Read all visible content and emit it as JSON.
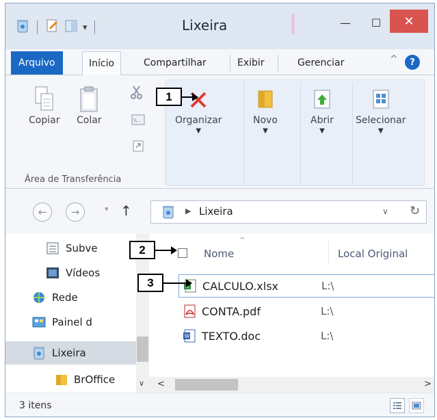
{
  "window": {
    "title": "Lixeira",
    "accent_color": "#1a68c4",
    "close_glyph": "✕",
    "minimize_glyph": "—",
    "maximize_glyph": "☐"
  },
  "ribbon_tabs": {
    "file": "Arquivo",
    "home": "Início",
    "share": "Compartilhar",
    "view": "Exibir",
    "manage": "Gerenciar",
    "help": "?",
    "collapse": "^"
  },
  "ribbon": {
    "copy": "Copiar",
    "paste": "Colar",
    "clipboard_group": "Área de Transferência",
    "organize": "Organizar",
    "new": "Novo",
    "open": "Abrir",
    "select": "Selecionar"
  },
  "address": {
    "location": "Lixeira",
    "back": "←",
    "forward": "→",
    "up": "↑",
    "refresh": "↻"
  },
  "nav_pane": {
    "items": [
      "Subve",
      "Vídeos",
      "Rede",
      "Painel d",
      "Lixeira",
      "BrOffice"
    ]
  },
  "columns": {
    "name": "Nome",
    "original_location": "Local Original"
  },
  "files": [
    {
      "name": "CALCULO.xlsx",
      "location": "L:\\",
      "icon": "excel-icon"
    },
    {
      "name": "CONTA.pdf",
      "location": "L:\\",
      "icon": "pdf-icon"
    },
    {
      "name": "TEXTO.doc",
      "location": "L:\\",
      "icon": "word-icon"
    }
  ],
  "status": {
    "count": "3 itens"
  },
  "callouts": [
    "1",
    "2",
    "3"
  ]
}
